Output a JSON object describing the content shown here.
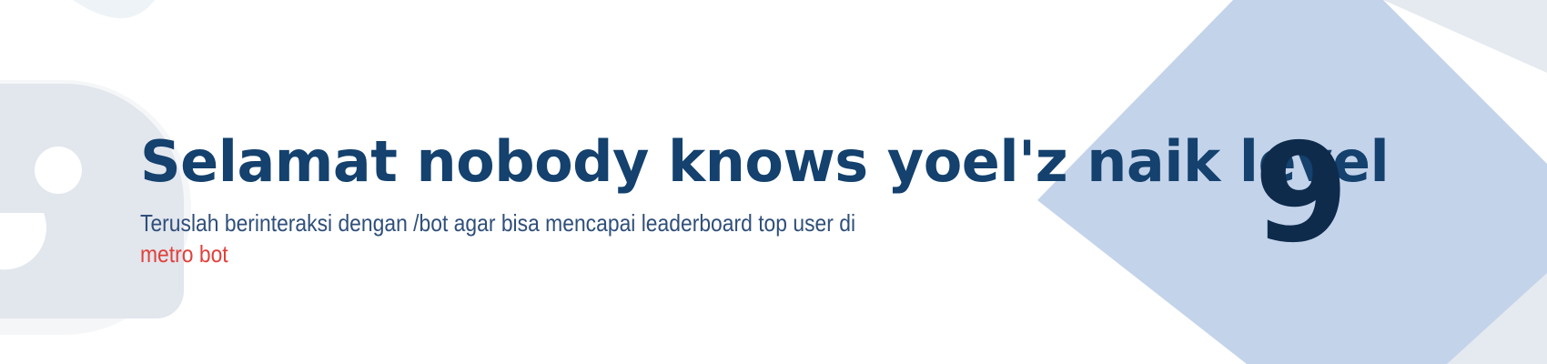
{
  "banner": {
    "headline": "Selamat nobody knows yoel'z naik level",
    "subtitle_text": "Teruslah berinteraksi dengan /bot agar bisa mencapai leaderboard top user di",
    "subtitle_highlight": "metro bot",
    "level_number": "9"
  },
  "colors": {
    "headline": "#14416d",
    "subtitle": "#2f4f7a",
    "highlight": "#e0413a",
    "level_number": "#0e2b4c",
    "diamond": "#c3d3ea",
    "watermark": "#e4e9ef"
  },
  "icons": {
    "watermark": "bot-face-icon",
    "decoration": "diamond-shape"
  }
}
